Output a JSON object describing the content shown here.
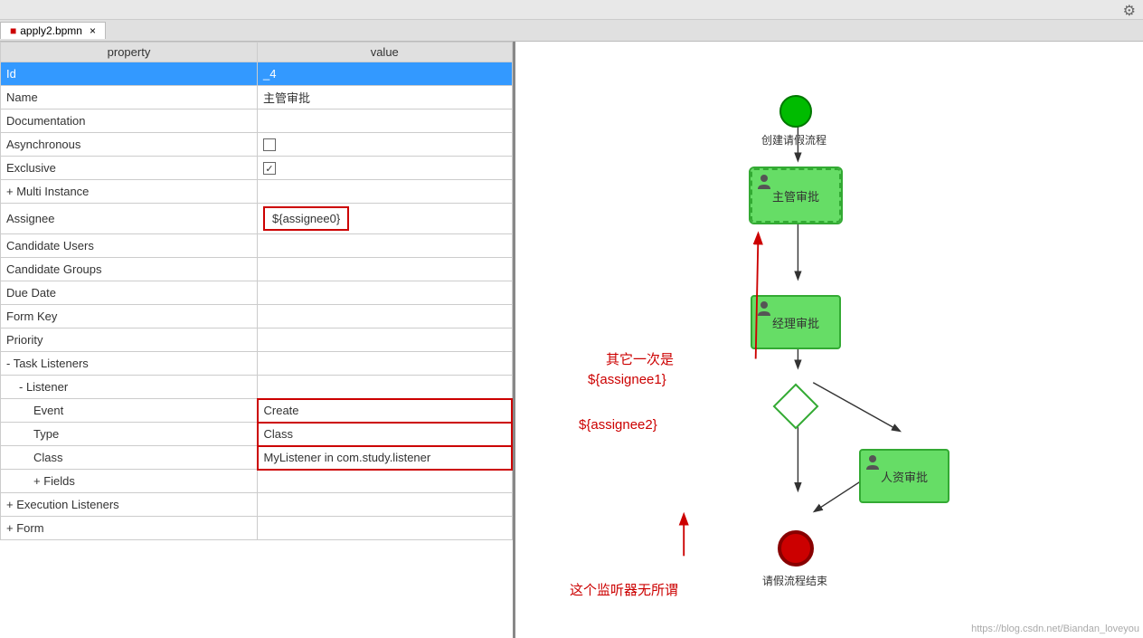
{
  "topbar": {
    "gear_label": "⚙"
  },
  "tab": {
    "label": "apply2.bpmn",
    "close": "×"
  },
  "table": {
    "col_property": "property",
    "col_value": "value",
    "rows": [
      {
        "id": "id-row",
        "property": "Id",
        "value": "_4",
        "selected": true,
        "indent": 0
      },
      {
        "id": "name-row",
        "property": "Name",
        "value": "主管审批",
        "selected": false,
        "indent": 0
      },
      {
        "id": "doc-row",
        "property": "Documentation",
        "value": "",
        "selected": false,
        "indent": 0
      },
      {
        "id": "async-row",
        "property": "Asynchronous",
        "value": "checkbox_empty",
        "selected": false,
        "indent": 0
      },
      {
        "id": "excl-row",
        "property": "Exclusive",
        "value": "checkbox_checked",
        "selected": false,
        "indent": 0
      },
      {
        "id": "multi-row",
        "property": "Multi Instance",
        "value": "",
        "selected": false,
        "indent": 0,
        "expand": "+"
      },
      {
        "id": "assignee-row",
        "property": "Assignee",
        "value": "${assignee0}",
        "selected": false,
        "indent": 0,
        "highlight": true
      },
      {
        "id": "cand-users-row",
        "property": "Candidate Users",
        "value": "",
        "selected": false,
        "indent": 0
      },
      {
        "id": "cand-groups-row",
        "property": "Candidate Groups",
        "value": "",
        "selected": false,
        "indent": 0
      },
      {
        "id": "due-date-row",
        "property": "Due Date",
        "value": "",
        "selected": false,
        "indent": 0
      },
      {
        "id": "form-key-row",
        "property": "Form Key",
        "value": "",
        "selected": false,
        "indent": 0
      },
      {
        "id": "priority-row",
        "property": "Priority",
        "value": "",
        "selected": false,
        "indent": 0
      },
      {
        "id": "task-listeners-row",
        "property": "Task Listeners",
        "value": "",
        "selected": false,
        "indent": 0,
        "expand": "-"
      },
      {
        "id": "listener-row",
        "property": "Listener",
        "value": "",
        "selected": false,
        "indent": 1,
        "expand": "-"
      },
      {
        "id": "event-row",
        "property": "Event",
        "value": "Create",
        "selected": false,
        "indent": 2,
        "highlight_listener": true
      },
      {
        "id": "type-row",
        "property": "Type",
        "value": "Class",
        "selected": false,
        "indent": 2,
        "highlight_listener": true
      },
      {
        "id": "class-row",
        "property": "Class",
        "value": "MyListener in com.study.listener",
        "selected": false,
        "indent": 2,
        "highlight_listener": true
      },
      {
        "id": "fields-row",
        "property": "Fields",
        "value": "",
        "selected": false,
        "indent": 2,
        "expand": "+"
      },
      {
        "id": "exec-listeners-row",
        "property": "Execution Listeners",
        "value": "",
        "selected": false,
        "indent": 0,
        "expand": "+"
      },
      {
        "id": "form-row",
        "property": "Form",
        "value": "",
        "selected": false,
        "indent": 0,
        "expand": "+"
      }
    ]
  },
  "diagram": {
    "annotation1": "其它一次是",
    "annotation2": "${assignee1}",
    "annotation3": "${assignee2}",
    "annotation4": "这个监听器无所谓",
    "nodes": {
      "start_label": "创建请假流程",
      "task1_label": "主管审批",
      "task2_label": "经理审批",
      "task3_label": "人资审批",
      "end_label": "请假流程结束"
    }
  },
  "watermark": "https://blog.csdn.net/Biandan_loveyou"
}
